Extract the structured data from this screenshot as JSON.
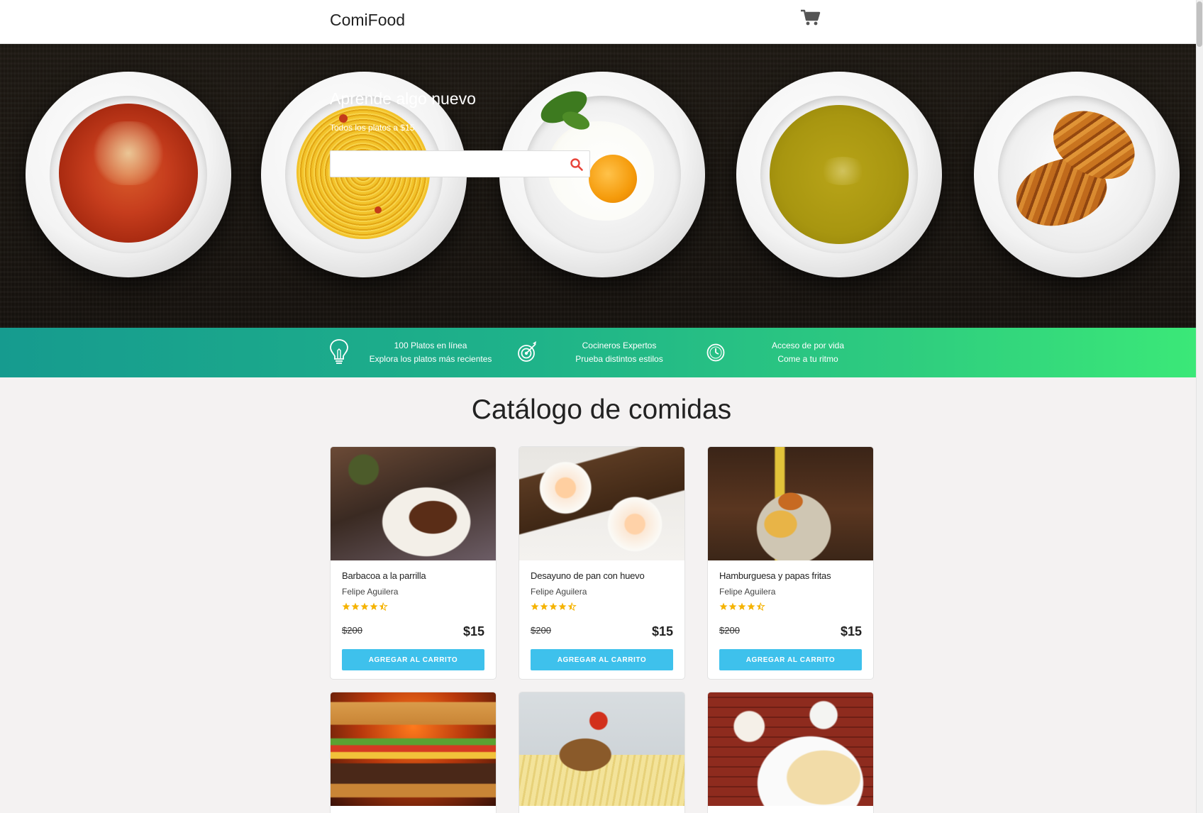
{
  "header": {
    "brand": "ComiFood",
    "cart_icon": "shopping-cart-icon"
  },
  "hero": {
    "title": "Aprende algo nuevo",
    "subtitle": "Todos los platos a $15",
    "search_placeholder": "",
    "search_icon": "search-icon",
    "plates": [
      "tomato-soup",
      "spaghetti",
      "fried-egg",
      "cream-soup",
      "croissants"
    ]
  },
  "features": [
    {
      "icon": "lightbulb-icon",
      "line1": "100 Platos en línea",
      "line2": "Explora los platos más recientes"
    },
    {
      "icon": "target-icon",
      "line1": "Cocineros Expertos",
      "line2": "Prueba distintos estilos"
    },
    {
      "icon": "clock-icon",
      "line1": "Acceso de por vida",
      "line2": "Come a tu ritmo"
    }
  ],
  "catalog": {
    "title": "Catálogo de comidas",
    "button_label": "AGREGAR AL CARRITO",
    "cards": [
      {
        "name": "Barbacoa a la parrilla",
        "author": "Felipe Aguilera",
        "rating": 4.5,
        "old_price": "$200",
        "price": "$15",
        "image": "grilled-steak"
      },
      {
        "name": "Desayuno de pan con huevo",
        "author": "Felipe Aguilera",
        "rating": 4.5,
        "old_price": "$200",
        "price": "$15",
        "image": "toast-with-eggs"
      },
      {
        "name": "Hamburguesa y papas fritas",
        "author": "Felipe Aguilera",
        "rating": 4.5,
        "old_price": "$200",
        "price": "$15",
        "image": "burger-and-fries"
      },
      {
        "name": "",
        "author": "",
        "rating": null,
        "old_price": "",
        "price": "",
        "image": "cheeseburger"
      },
      {
        "name": "",
        "author": "",
        "rating": null,
        "old_price": "",
        "price": "",
        "image": "grilled-chicken-pasta"
      },
      {
        "name": "",
        "author": "",
        "rating": null,
        "old_price": "",
        "price": "",
        "image": "crepes-and-eggs"
      }
    ]
  },
  "colors": {
    "accent_button": "#3ec1ec",
    "star": "#f5b301",
    "features_gradient_start": "#169b8f",
    "features_gradient_end": "#3be878"
  }
}
